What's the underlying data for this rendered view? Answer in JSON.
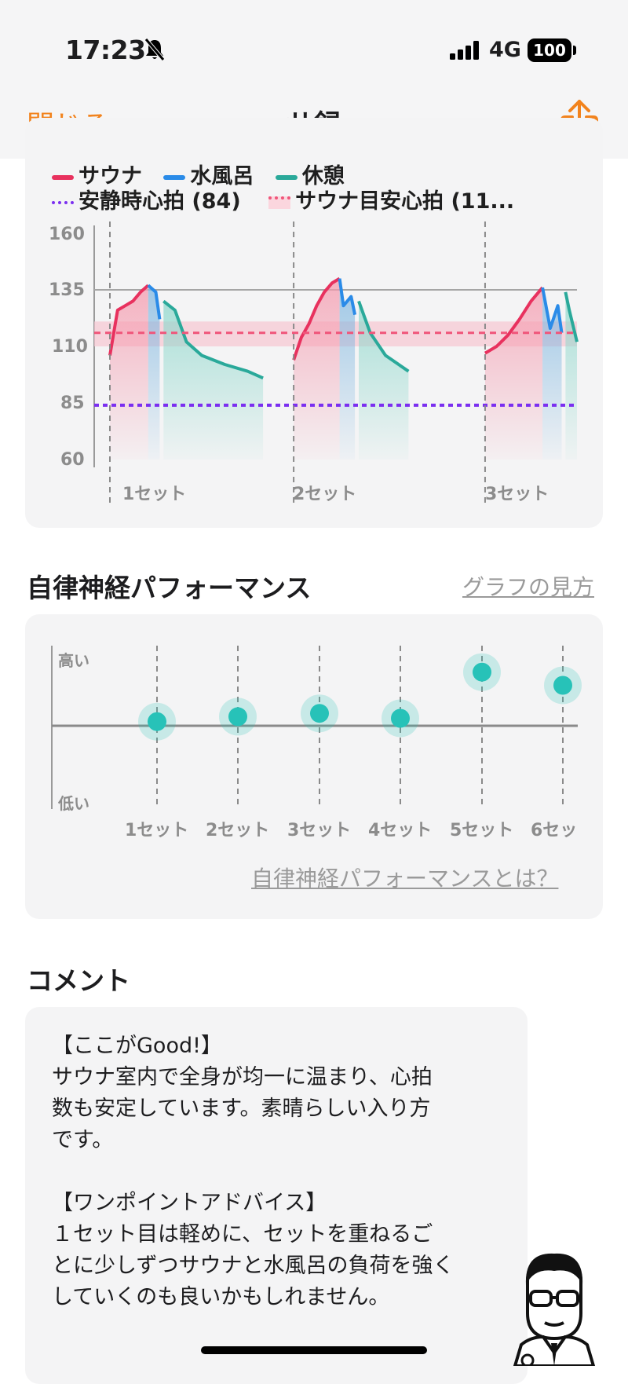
{
  "status_bar": {
    "time": "17:23",
    "network": "4G",
    "battery": "100"
  },
  "nav": {
    "close_label": "閉じる",
    "title": "サ録"
  },
  "heart_chart": {
    "legend": [
      {
        "label": "サウナ",
        "color": "#e8315e",
        "style": "solid"
      },
      {
        "label": "水風呂",
        "color": "#2a8be8",
        "style": "solid"
      },
      {
        "label": "休憩",
        "color": "#2aa99a",
        "style": "solid"
      },
      {
        "label": "安静時心拍 (84)",
        "color": "#7b2ff0",
        "style": "dotted"
      },
      {
        "label": "サウナ目安心拍 (11...",
        "color": "#f0557a",
        "style": "dotted"
      }
    ],
    "y_ticks": [
      "160",
      "135",
      "110",
      "85",
      "60"
    ],
    "set_labels": [
      "1セット",
      "2セット",
      "3セット"
    ]
  },
  "chart_data": [
    {
      "type": "line",
      "ylim": [
        60,
        160
      ],
      "y_ticks": [
        160,
        135,
        110,
        85,
        60
      ],
      "resting_hr": 84,
      "sauna_target_band": [
        110,
        121
      ],
      "sauna_target_line": 116,
      "set_labels": [
        "1セット",
        "2セット",
        "3セット"
      ],
      "series": [
        {
          "name": "サウナ",
          "values": [
            [
              0,
              106
            ],
            [
              2,
              126
            ],
            [
              4,
              128
            ],
            [
              6,
              130
            ],
            [
              8,
              134
            ],
            [
              10,
              137
            ],
            [
              48,
              104
            ],
            [
              50,
              114
            ],
            [
              52,
              120
            ],
            [
              54,
              128
            ],
            [
              56,
              134
            ],
            [
              58,
              138
            ],
            [
              60,
              140
            ],
            [
              98,
              107
            ],
            [
              101,
              110
            ],
            [
              104,
              115
            ],
            [
              107,
              122
            ],
            [
              110,
              130
            ],
            [
              113,
              136
            ]
          ]
        },
        {
          "name": "水風呂",
          "values": [
            [
              10,
              137
            ],
            [
              12,
              134
            ],
            [
              13,
              122
            ],
            [
              60,
              140
            ],
            [
              61,
              128
            ],
            [
              63,
              132
            ],
            [
              64,
              124
            ],
            [
              113,
              136
            ],
            [
              115,
              118
            ],
            [
              117,
              128
            ],
            [
              118,
              116
            ]
          ]
        },
        {
          "name": "休憩",
          "values": [
            [
              14,
              130
            ],
            [
              17,
              126
            ],
            [
              20,
              112
            ],
            [
              24,
              106
            ],
            [
              30,
              102
            ],
            [
              36,
              99
            ],
            [
              40,
              96
            ],
            [
              65,
              130
            ],
            [
              68,
              116
            ],
            [
              72,
              106
            ],
            [
              78,
              99
            ],
            [
              85,
              98
            ],
            [
              92,
              96
            ],
            [
              119,
              134
            ],
            [
              120,
              126
            ],
            [
              122,
              112
            ]
          ]
        }
      ]
    },
    {
      "type": "scatter",
      "title": "自律神経パフォーマンス",
      "categories": [
        "1セット",
        "2セット",
        "3セット",
        "4セット",
        "5セット",
        "6セッ"
      ],
      "values": [
        0.53,
        0.56,
        0.58,
        0.55,
        0.83,
        0.75
      ],
      "ylabel_high": "高い",
      "ylabel_low": "低い"
    }
  ],
  "ans": {
    "title": "自律神経パフォーマンス",
    "how_to_read": "グラフの見方",
    "high": "高い",
    "low": "低い",
    "set_labels": [
      "1セット",
      "2セット",
      "3セット",
      "4セット",
      "5セット",
      "6セッ"
    ],
    "what_is": "自律神経パフォーマンスとは？",
    "accent": "#27c2b8"
  },
  "comment": {
    "title": "コメント",
    "text": "【ここがGood!】\nサウナ室内で全身が均一に温まり、心拍\n数も安定しています。素晴らしい入り方\nです。\n\n【ワンポイントアドバイス】\n１セット目は軽めに、セットを重ねるご\nとに少しずつサウナと水風呂の負荷を強く\nしていくのも良いかもしれません。"
  }
}
